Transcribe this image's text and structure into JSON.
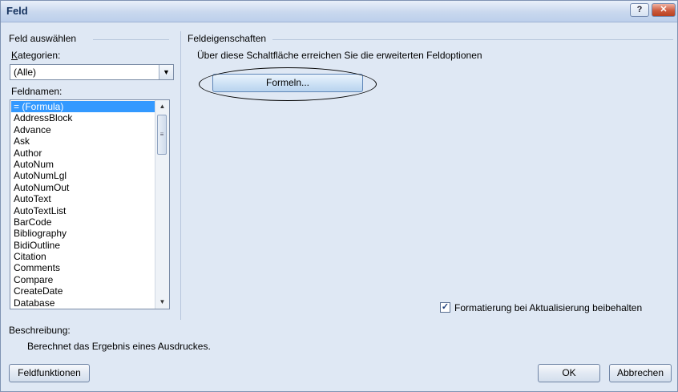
{
  "window": {
    "title": "Feld",
    "help_label": "?",
    "close_label": "✕"
  },
  "left": {
    "section_label": "Feld auswählen",
    "categories_label": "Kategorien:",
    "category_value": "(Alle)",
    "fieldnames_label": "Feldnamen:",
    "fieldnames": [
      "= (Formula)",
      "AddressBlock",
      "Advance",
      "Ask",
      "Author",
      "AutoNum",
      "AutoNumLgl",
      "AutoNumOut",
      "AutoText",
      "AutoTextList",
      "BarCode",
      "Bibliography",
      "BidiOutline",
      "Citation",
      "Comments",
      "Compare",
      "CreateDate",
      "Database"
    ],
    "selected_index": 0
  },
  "right": {
    "section_label": "Feldeigenschaften",
    "hint": "Über diese Schaltfläche erreichen Sie die erweiterten Feldoptionen",
    "formeln_button": "Formeln...",
    "preserve_format_label": "Formatierung bei Aktualisierung beibehalten",
    "preserve_format_checked": true
  },
  "description": {
    "label": "Beschreibung:",
    "text": "Berechnet das Ergebnis eines Ausdruckes."
  },
  "footer": {
    "field_codes_button": "Feldfunktionen",
    "ok_button": "OK",
    "cancel_button": "Abbrechen"
  },
  "colors": {
    "selection": "#3399ff",
    "dialog_bg": "#dfe8f4"
  }
}
